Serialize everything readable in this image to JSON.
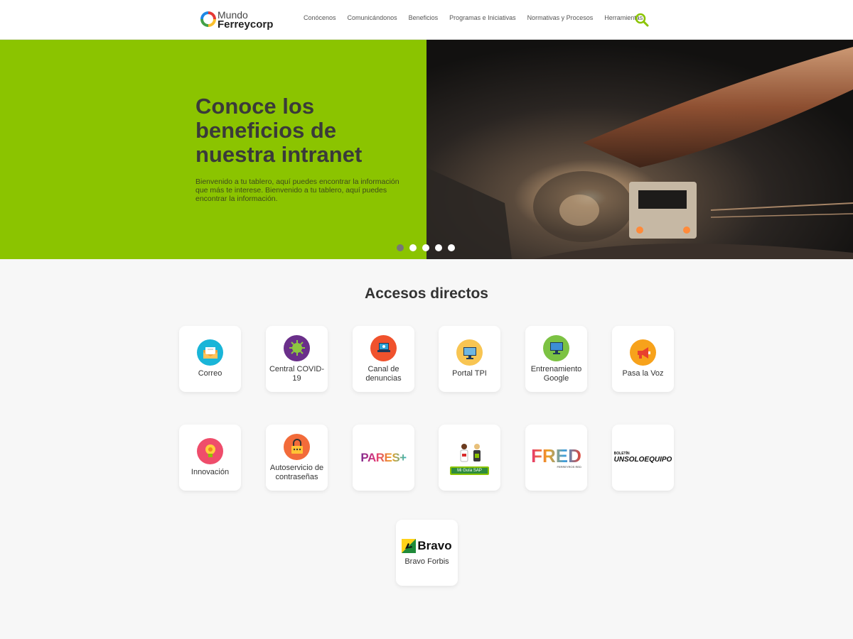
{
  "header": {
    "logo_top": "Mundo",
    "logo_bottom": "Ferreycorp",
    "nav": [
      "Conócenos",
      "Comunicándonos",
      "Beneficios",
      "Programas e Iniciativas",
      "Normativas y Procesos",
      "Herramientas"
    ]
  },
  "hero": {
    "title": "Conoce los beneficios de nuestra intranet",
    "text": "Bienvenido a tu tablero, aquí puedes encontrar la información que más te interese. Bienvenido a tu tablero, aquí puedes encontrar la información.",
    "dots_count": 5,
    "active_dot": 0
  },
  "accesos": {
    "title": "Accesos directos",
    "items": [
      {
        "label": "Correo",
        "icon": "mail-icon"
      },
      {
        "label": "Central COVID-19",
        "icon": "virus-icon"
      },
      {
        "label": "Canal de denuncias",
        "icon": "laptop-alert-icon"
      },
      {
        "label": "Portal TPI",
        "icon": "monitor-icon"
      },
      {
        "label": "Entrenamiento Google",
        "icon": "screen-icon"
      },
      {
        "label": "Pasa la Voz",
        "icon": "megaphone-icon"
      },
      {
        "label": "Innovación",
        "icon": "lightbulb-icon"
      },
      {
        "label": "Autoservicio de contraseñas",
        "icon": "lock-icon"
      },
      {
        "label": "",
        "logo_text": "PARES+"
      },
      {
        "label": "",
        "logo_text": "Mi Guía SAP"
      },
      {
        "label": "",
        "logo_text": "FRED",
        "logo_sub": "FERREYROS RED"
      },
      {
        "label": "",
        "logo_text": "UNSOLOEQUIPO",
        "logo_sub": "BOLETÍN"
      },
      {
        "label": "Bravo Forbis",
        "logo_text": "Bravo"
      }
    ]
  },
  "colors": {
    "accent": "#8bc400",
    "nav_text": "#555555",
    "card_bg": "#ffffff"
  }
}
